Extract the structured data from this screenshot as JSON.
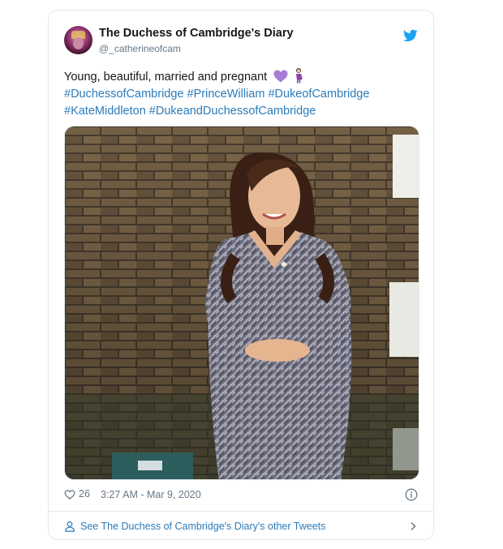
{
  "tweet": {
    "author_name": "The Duchess of Cambridge's Diary",
    "author_handle": "@_catherineofcam",
    "text_line1": "Young, beautiful, married and pregnant",
    "hashtags_line2": [
      "#DuchessofCambridge",
      "#PrinceWilliam",
      "#DukeofCambridge"
    ],
    "hashtags_line3": [
      "#KateMiddleton",
      "#DukeandDuchessofCambridge"
    ],
    "like_count": "26",
    "timestamp": "3:27 AM - Mar 9, 2020",
    "see_more_label": "See The Duchess of Cambridge's Diary's other Tweets"
  },
  "icons": {
    "brand": "twitter-bird-icon",
    "emoji1": "purple-heart-icon",
    "emoji2": "pregnant-woman-icon",
    "like": "heart-icon",
    "info": "info-icon",
    "person": "person-icon",
    "chevron": "chevron-right-icon"
  },
  "colors": {
    "link": "#2b7bb9",
    "twitter_blue": "#1da1f2",
    "muted": "#657786",
    "border": "#e1e8ed",
    "heart_emoji": "#a77bd6"
  }
}
